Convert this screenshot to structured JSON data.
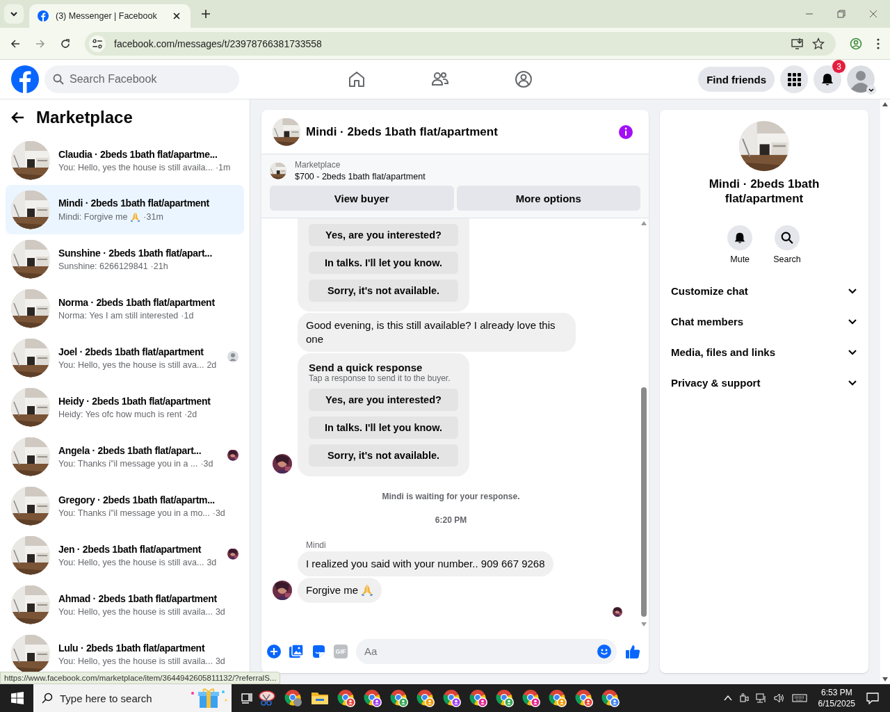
{
  "browser": {
    "tabs": [
      {
        "title": "(3) Messenger | Facebook",
        "selected": true
      }
    ],
    "url": "facebook.com/messages/t/23978766381733558"
  },
  "header": {
    "search": {
      "placeholder": "Search Facebook"
    },
    "find_friends": "Find friends",
    "notification_count": "3"
  },
  "sidebar": {
    "title": "Marketplace",
    "conversations": [
      {
        "title": "Claudia · 2beds 1bath flat/apartme...",
        "preview": "You: Hello, yes the house is still availa...",
        "time": "·1m",
        "selected": false,
        "kind": "plain"
      },
      {
        "title": "Mindi · 2beds 1bath flat/apartment",
        "preview": "Mindi: Forgive me",
        "kind": "emoji",
        "time": "·31m",
        "selected": true
      },
      {
        "title": "Sunshine · 2beds 1bath flat/apart...",
        "preview": "Sunshine: 6266129841",
        "time": "·21h",
        "selected": false,
        "kind": "plain"
      },
      {
        "title": "Norma · 2beds 1bath flat/apartment",
        "preview": "Norma: Yes I am still interested",
        "time": "·1d",
        "selected": false,
        "kind": "plain"
      },
      {
        "title": "Joel · 2beds 1bath flat/apartment",
        "preview": "You: Hello, yes the house is still ava...",
        "time": "2d",
        "selected": false,
        "kind": "seen-avatar"
      },
      {
        "title": "Heidy · 2beds 1bath flat/apartment",
        "preview": "Heidy: Yes ofc how much is rent",
        "time": "·2d",
        "selected": false,
        "kind": "plain"
      },
      {
        "title": "Angela · 2beds 1bath flat/apart...",
        "preview": "You: Thanks i\"il message you in a ...",
        "time": "·3d",
        "selected": false,
        "kind": "seen-photo"
      },
      {
        "title": "Gregory · 2beds 1bath flat/apartm...",
        "preview": "You: Thanks i\"il message you in a mo...",
        "time": "·3d",
        "selected": false,
        "kind": "plain"
      },
      {
        "title": "Jen · 2beds 1bath flat/apartment",
        "preview": "You: Hello, yes the house is still ava...",
        "time": "3d",
        "selected": false,
        "kind": "seen-photo"
      },
      {
        "title": "Ahmad · 2beds 1bath flat/apartment",
        "preview": "You: Hello, yes the house is still availa...",
        "time": "3d",
        "selected": false,
        "kind": "plain"
      },
      {
        "title": "Lulu · 2beds 1bath flat/apartment",
        "preview": "You: Hello, yes the house is still availa...",
        "time": "3d",
        "selected": false,
        "kind": "plain"
      }
    ]
  },
  "chat": {
    "title": "Mindi · 2beds 1bath flat/apartment",
    "listing": {
      "label": "Marketplace",
      "detail": "$700 - 2beds 1bath flat/apartment"
    },
    "buttons": [
      "View buyer",
      "More options"
    ],
    "messages": [
      {
        "kind": "quick",
        "options": [
          "Yes, are you interested?",
          "In talks. I'll let you know.",
          "Sorry, it's not available."
        ]
      },
      {
        "kind": "text",
        "text": "Good evening, is this still available? I already love this one",
        "avatar": false
      },
      {
        "kind": "quick",
        "title": "Send a quick response",
        "hint": "Tap a response to send it to the buyer.",
        "avatar": true,
        "options": [
          "Yes, are you interested?",
          "In talks. I'll let you know.",
          "Sorry, it's not available."
        ]
      },
      {
        "kind": "notice",
        "text": "Mindi is waiting for your response."
      },
      {
        "kind": "time",
        "text": "6:20 PM"
      },
      {
        "kind": "sender",
        "text": "Mindi"
      },
      {
        "kind": "text",
        "text": "I realized you said with your number.. 909 667 9268",
        "avatar": false
      },
      {
        "kind": "emoji-text",
        "text": "Forgive me",
        "avatar": true
      },
      {
        "kind": "seen"
      }
    ],
    "composer": {
      "placeholder": "Aa",
      "gif": "GIF"
    }
  },
  "details": {
    "name": "Mindi · 2beds 1bath flat/apartment",
    "actions": [
      {
        "kind": "mute",
        "label": "Mute"
      },
      {
        "kind": "search",
        "label": "Search"
      }
    ],
    "sections": [
      {
        "label": "Customize chat",
        "expanded": false
      },
      {
        "label": "Chat members",
        "expanded": false
      },
      {
        "label": "Media, files and links",
        "expanded": false
      },
      {
        "label": "Privacy & support",
        "expanded": false
      }
    ]
  },
  "status_url": "https://www.facebook.com/marketplace/item/3644942605811132/?referralS...",
  "taskbar": {
    "search": {
      "placeholder": "Type here to search"
    },
    "time": "6:53 PM",
    "date": "6/15/2025",
    "apps": [
      {
        "kind": "snip"
      },
      {
        "kind": "chrome"
      },
      {
        "kind": "explorer"
      },
      {
        "kind": "chrome",
        "color": "#e8453c"
      },
      {
        "kind": "chrome",
        "color": "#a142f4"
      },
      {
        "kind": "chrome",
        "color": "#34a853"
      },
      {
        "kind": "chrome",
        "color": "#f29900"
      },
      {
        "kind": "chrome",
        "color": "#a142f4"
      },
      {
        "kind": "chrome",
        "color": "#e52592"
      },
      {
        "kind": "chrome",
        "color": "#34a853"
      },
      {
        "kind": "chrome",
        "color": "#e52592"
      },
      {
        "kind": "chrome",
        "color": "#f29900"
      },
      {
        "kind": "chrome",
        "color": "#e8453c"
      },
      {
        "kind": "chrome",
        "color": "#4285f4"
      }
    ]
  }
}
